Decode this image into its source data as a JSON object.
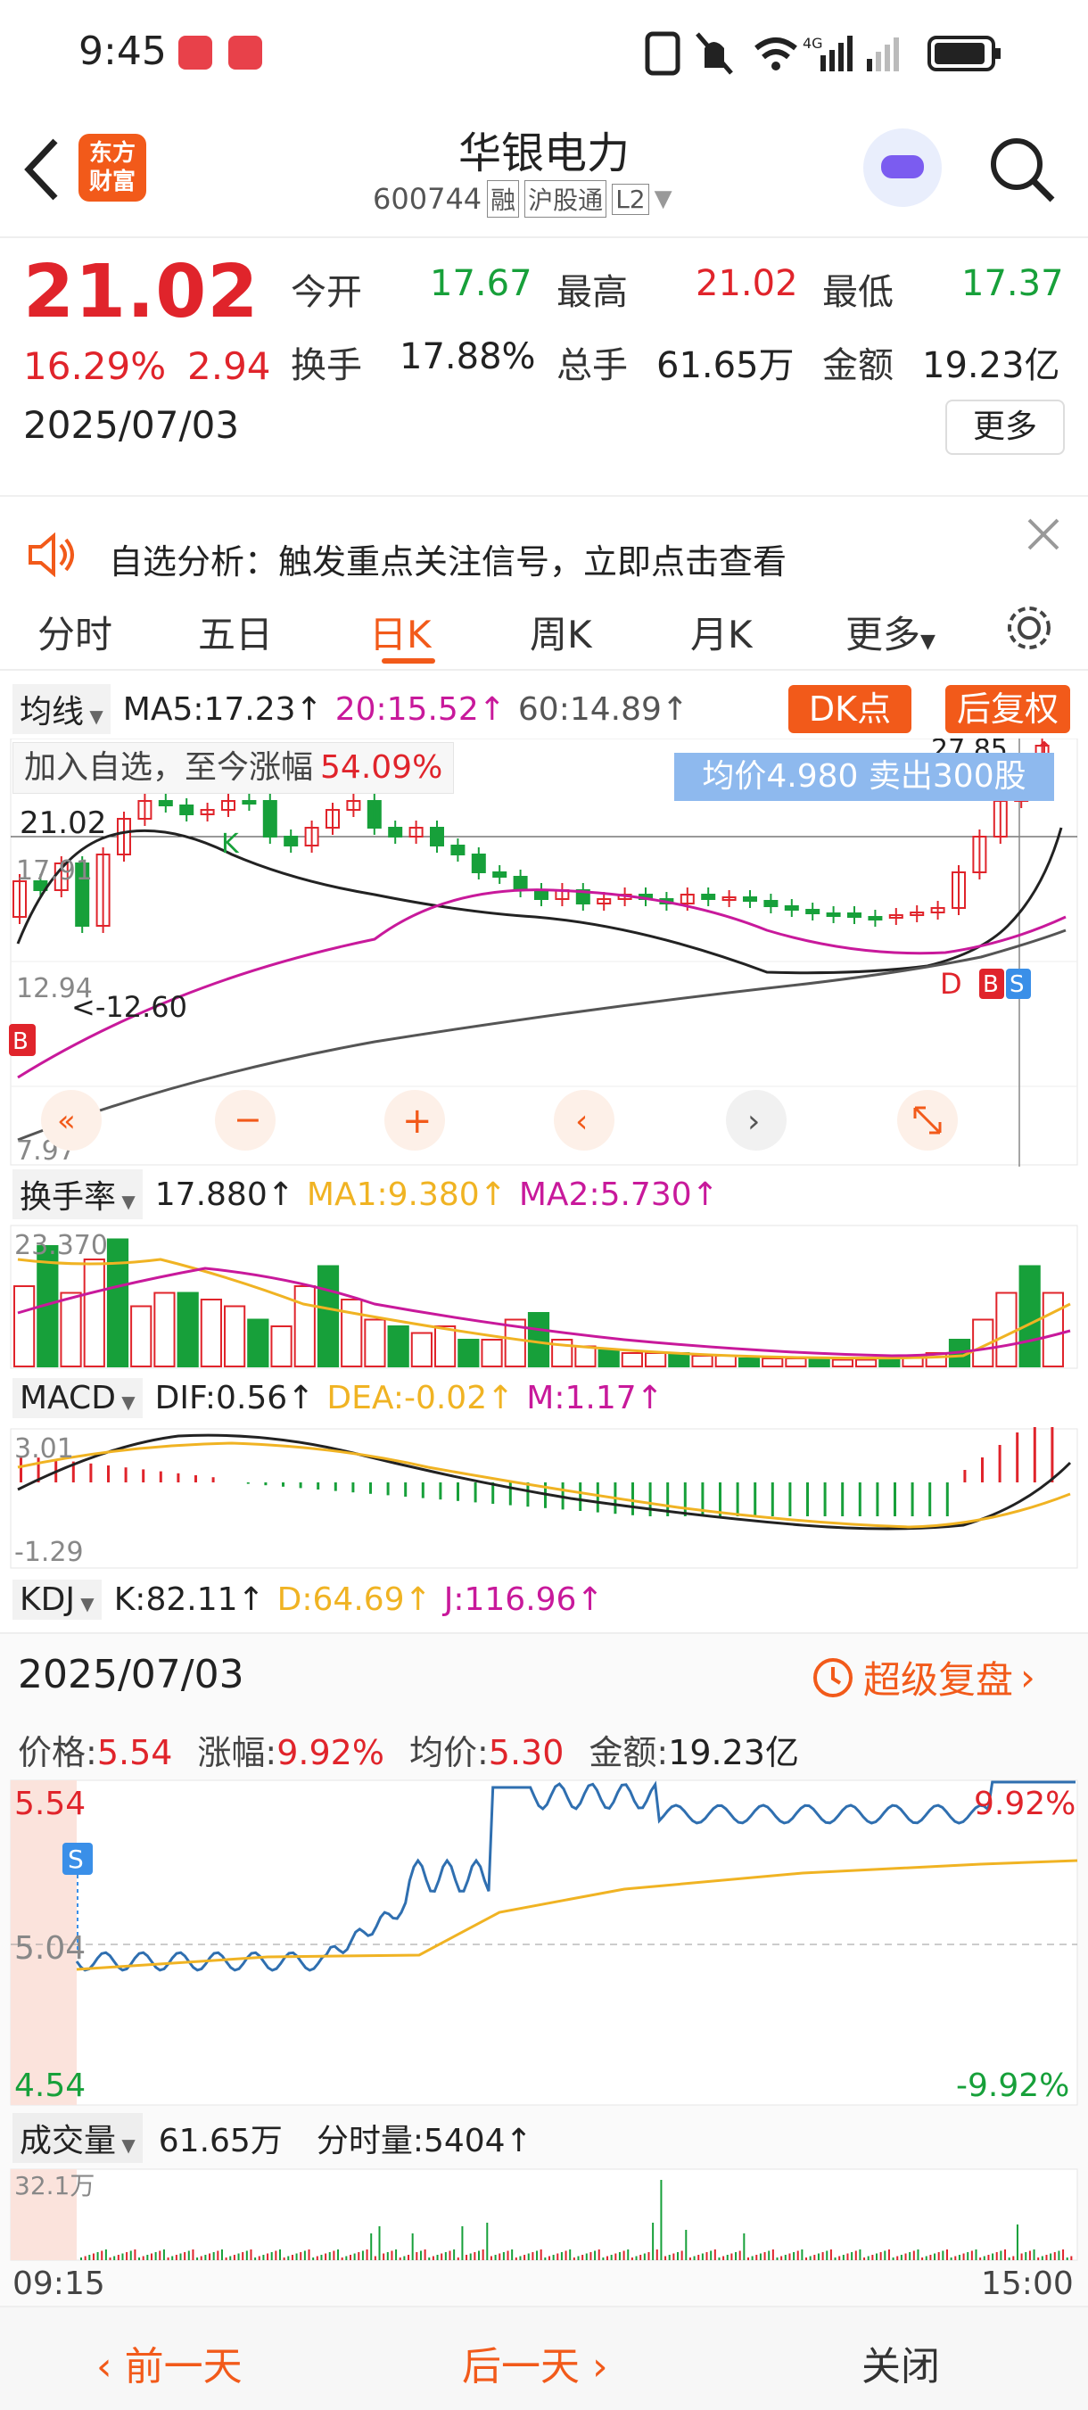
{
  "status": {
    "time": "9:45",
    "net": "4G"
  },
  "header": {
    "title": "华银电力",
    "code": "600744",
    "badges": [
      "融",
      "沪股通",
      "L2"
    ],
    "logo_text": "东方\n财富"
  },
  "quote": {
    "price": "21.02",
    "change_pct": "16.29%",
    "change": "2.94",
    "date": "2025/07/03",
    "open_label": "今开",
    "open": "17.67",
    "high_label": "最高",
    "high": "21.02",
    "low_label": "最低",
    "low": "17.37",
    "turnover_label": "换手",
    "turnover": "17.88%",
    "volume_label": "总手",
    "volume": "61.65万",
    "amount_label": "金额",
    "amount": "19.23亿",
    "more_button": "更多"
  },
  "banner": {
    "text": "自选分析：触发重点关注信号，立即点击查看"
  },
  "tabs": [
    "分时",
    "五日",
    "日K",
    "周K",
    "月K",
    "更多"
  ],
  "active_tab": "日K",
  "kline": {
    "ma_selector": "均线",
    "ma5": "MA5:17.23↑",
    "ma10": "20:15.52↑",
    "ma60": "60:14.89↑",
    "dk_button": "DK点",
    "restore_button": "后复权",
    "add_watch_label": "加入自选，至今涨幅",
    "add_watch_value": "54.09%",
    "tooltip": "均价4.980  卖出300股",
    "level_top": "27.85",
    "level_price": "21.02",
    "level_1": "17.91",
    "level_2": "12.94",
    "level_low": "7.97",
    "low_marker": "<-12.60",
    "peak_marker": "K",
    "signal_b": "B",
    "signal_d": "D",
    "signal_s": "S"
  },
  "turnover_ind": {
    "selector": "换手率",
    "value": "17.880↑",
    "ma1": "MA1:9.380↑",
    "ma2": "MA2:5.730↑",
    "max": "23.370"
  },
  "macd_ind": {
    "selector": "MACD",
    "dif": "DIF:0.56↑",
    "dea": "DEA:-0.02↑",
    "m": "M:1.17↑",
    "max": "3.01",
    "min": "-1.29"
  },
  "kdj_ind": {
    "selector": "KDJ",
    "k": "K:82.11↑",
    "d": "D:64.69↑",
    "j": "J:116.96↑"
  },
  "intraday": {
    "date": "2025/07/03",
    "replay_button": "超级复盘",
    "price_label": "价格:",
    "price": "5.54",
    "chg_label": "涨幅:",
    "chg": "9.92%",
    "avg_label": "均价:",
    "avg": "5.30",
    "amount_label": "金额:",
    "amount": "19.23亿",
    "y_max": "5.54",
    "y_mid": "5.04",
    "y_min": "4.54",
    "pct_max": "9.92%",
    "pct_min": "-9.92%",
    "s_marker": "S",
    "vol_selector": "成交量",
    "vol_total": "61.65万",
    "vol_minute": "分时量:5404↑",
    "vol_max": "32.1万",
    "time_start": "09:15",
    "time_end": "15:00"
  },
  "bottom": {
    "prev": "前一天",
    "next": "后一天",
    "close": "关闭"
  },
  "colors": {
    "up": "#e0242b",
    "down": "#17a03a",
    "accent": "#f25a1a",
    "ma5": "#222222",
    "ma10": "#c8199b",
    "ma60": "#555555",
    "avg": "#f0b323",
    "line": "#2f6fb0"
  }
}
